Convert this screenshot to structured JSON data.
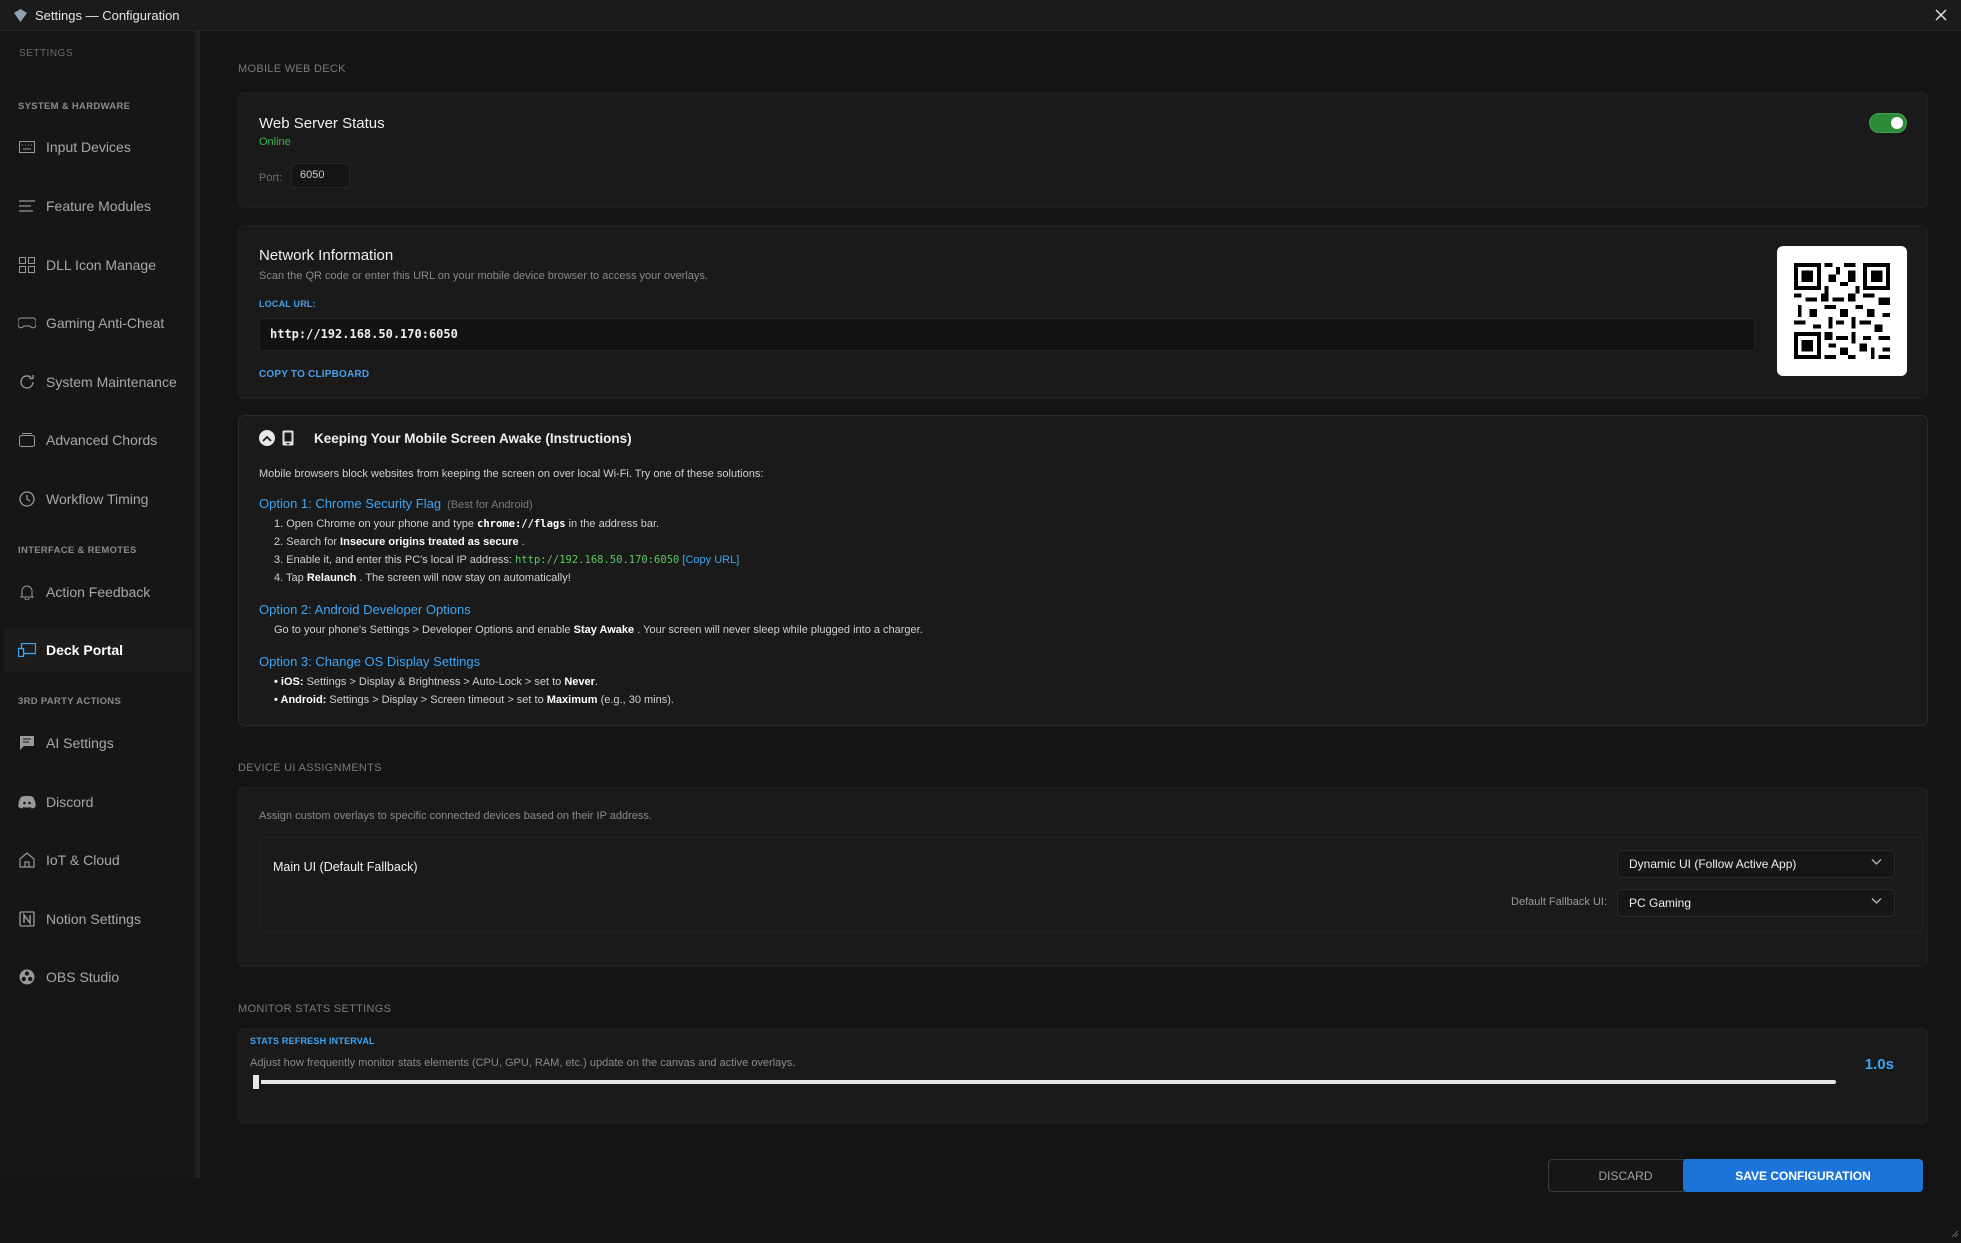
{
  "window": {
    "title": "Settings — Configuration"
  },
  "sidebar": {
    "heading": "SETTINGS",
    "groups": [
      {
        "label": "SYSTEM & HARDWARE"
      },
      {
        "label": "INTERFACE & REMOTES"
      },
      {
        "label": "3RD PARTY ACTIONS"
      }
    ],
    "items": [
      {
        "label": "Input Devices",
        "icon": "keyboard-icon"
      },
      {
        "label": "Feature Modules",
        "icon": "lines-icon"
      },
      {
        "label": "DLL Icon Manage",
        "icon": "grid-icon"
      },
      {
        "label": "Gaming Anti-Cheat",
        "icon": "gamepad-icon"
      },
      {
        "label": "System Maintenance",
        "icon": "refresh-icon"
      },
      {
        "label": "Advanced Chords",
        "icon": "layers-icon"
      },
      {
        "label": "Workflow Timing",
        "icon": "clock-icon"
      },
      {
        "label": "Action Feedback",
        "icon": "bell-icon"
      },
      {
        "label": "Deck Portal",
        "icon": "devices-icon"
      },
      {
        "label": "AI Settings",
        "icon": "chat-icon"
      },
      {
        "label": "Discord",
        "icon": "discord-icon"
      },
      {
        "label": "IoT & Cloud",
        "icon": "home-icon"
      },
      {
        "label": "Notion Settings",
        "icon": "notion-icon"
      },
      {
        "label": "OBS Studio",
        "icon": "obs-icon"
      }
    ]
  },
  "mobile_web_deck": {
    "section_title": "MOBILE WEB DECK",
    "server": {
      "title": "Web Server Status",
      "status": "Online",
      "port_label": "Port:",
      "port_value": "6050",
      "enabled": true
    },
    "network": {
      "title": "Network Information",
      "description": "Scan the QR code or enter this URL on your mobile device browser to access your overlays.",
      "local_url_label": "LOCAL URL:",
      "local_url": "http://192.168.50.170:6050",
      "copy_label": "COPY TO CLIPBOARD"
    },
    "instructions": {
      "title": "Keeping Your Mobile Screen Awake (Instructions)",
      "intro": "Mobile browsers block websites from keeping the screen on over local Wi-Fi. Try one of these solutions:",
      "option1": {
        "title": "Option 1: Chrome Security Flag",
        "note": "(Best for Android)",
        "s1a": "1. Open Chrome on your phone and type",
        "s1code": "chrome://flags",
        "s1b": "in the address bar.",
        "s2a": "2. Search for",
        "s2b": "Insecure origins treated as secure",
        "s2c": ".",
        "s3a": "3. Enable it, and enter this PC's local IP address:",
        "s3code": "http://192.168.50.170:6050",
        "s3link": "[Copy URL]",
        "s4a": "4. Tap",
        "s4b": "Relaunch",
        "s4c": ". The screen will now stay on automatically!"
      },
      "option2": {
        "title": "Option 2: Android Developer Options",
        "a": "Go to your phone's Settings > Developer Options and enable",
        "b": "Stay Awake",
        "c": ". Your screen will never sleep while plugged into a charger."
      },
      "option3": {
        "title": "Option 3: Change OS Display Settings",
        "ios_label": "• iOS:",
        "ios_text": "Settings > Display & Brightness > Auto-Lock > set to",
        "ios_val": "Never",
        "ios_end": ".",
        "android_label": "• Android:",
        "android_text": "Settings > Display > Screen timeout > set to",
        "android_val": "Maximum",
        "android_end": "(e.g., 30 mins)."
      }
    }
  },
  "device_ui": {
    "section_title": "DEVICE UI ASSIGNMENTS",
    "description": "Assign custom overlays to specific connected devices based on their IP address.",
    "main_ui_label": "Main UI (Default Fallback)",
    "main_select": "Dynamic UI (Follow Active App)",
    "fallback_label": "Default Fallback UI:",
    "fallback_select": "PC Gaming"
  },
  "monitor_stats": {
    "section_title": "MONITOR STATS SETTINGS",
    "interval_label": "STATS REFRESH INTERVAL",
    "description": "Adjust how frequently monitor stats elements (CPU, GPU, RAM, etc.) update on the canvas and active overlays.",
    "value": "1.0s",
    "slider_fraction": 0.0
  },
  "footer": {
    "discard": "DISCARD",
    "save": "SAVE CONFIGURATION"
  },
  "colors": {
    "accent": "#3da5f4",
    "online": "#39b54a",
    "save": "#1d74d8"
  }
}
